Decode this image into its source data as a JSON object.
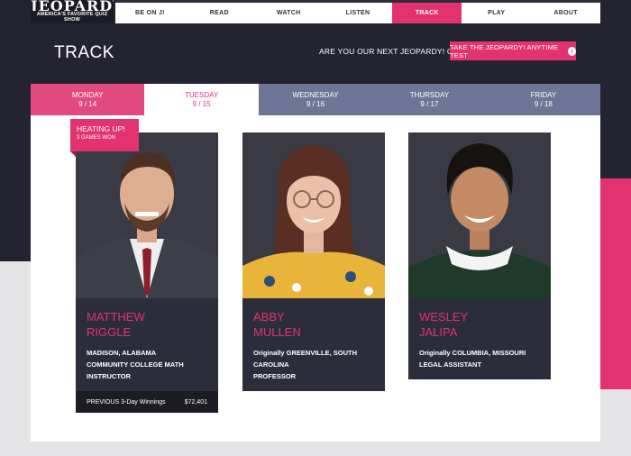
{
  "brand": {
    "logo_text": "JEOPARDY!",
    "tagline": "AMERICA'S FAVORITE QUIZ SHOW"
  },
  "nav": {
    "items": [
      {
        "label": "BE ON J!",
        "active": false
      },
      {
        "label": "READ",
        "active": false
      },
      {
        "label": "WATCH",
        "active": false
      },
      {
        "label": "LISTEN",
        "active": false
      },
      {
        "label": "TRACK",
        "active": true
      },
      {
        "label": "PLAY",
        "active": false
      },
      {
        "label": "ABOUT",
        "active": false
      }
    ]
  },
  "page": {
    "title": "TRACK",
    "champion_question": "ARE YOU OUR NEXT JEOPARDY! CHAMPION?",
    "test_button": "TAKE THE JEOPARDY! ANYTIME TEST"
  },
  "days": [
    {
      "day": "MONDAY",
      "date": "9 / 14",
      "state": "past"
    },
    {
      "day": "TUESDAY",
      "date": "9 / 15",
      "state": "today"
    },
    {
      "day": "WEDNESDAY",
      "date": "9 / 16",
      "state": "upcoming"
    },
    {
      "day": "THURSDAY",
      "date": "9 / 17",
      "state": "upcoming"
    },
    {
      "day": "FRIDAY",
      "date": "9 / 18",
      "state": "upcoming"
    }
  ],
  "badge": {
    "title": "HEATING UP!",
    "subtitle": "3 GAMES WON"
  },
  "contestants": [
    {
      "first": "MATTHEW",
      "last": "RIGGLE",
      "info": [
        "MADISON, ALABAMA",
        "COMMUNITY COLLEGE MATH",
        "INSTRUCTOR"
      ],
      "winnings_label": "PREVIOUS 3-Day Winnings",
      "winnings_value": "$72,401"
    },
    {
      "first": "ABBY",
      "last": "MULLEN",
      "info": [
        "Originally GREENVILLE, SOUTH",
        "CAROLINA",
        "PROFESSOR"
      ]
    },
    {
      "first": "WESLEY",
      "last": "JALIPA",
      "info": [
        "Originally COLUMBIA, MISSOURI",
        "LEGAL ASSISTANT"
      ]
    }
  ],
  "colors": {
    "accent": "#e23370",
    "dark": "#23242f",
    "tab_inactive": "#6d7696"
  }
}
